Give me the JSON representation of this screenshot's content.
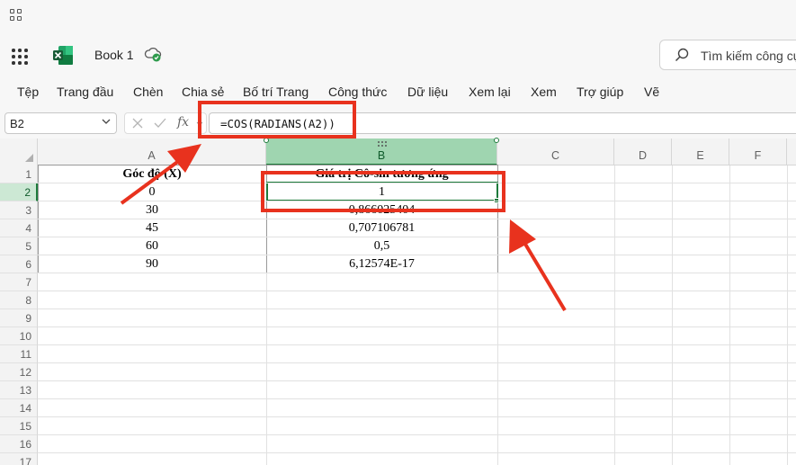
{
  "app": {
    "book_name": "Book 1",
    "search_placeholder": "Tìm kiếm công cụ"
  },
  "ribbon": {
    "tabs": [
      "Tệp",
      "Trang đầu",
      "Chèn",
      "Chia sẻ",
      "Bố trí Trang",
      "Công thức",
      "Dữ liệu",
      "Xem lại",
      "Xem",
      "Trợ giúp",
      "Vẽ"
    ]
  },
  "formula_bar": {
    "name_box": "B2",
    "fx_label": "fx",
    "formula": "=COS(RADIANS(A2))"
  },
  "sheet": {
    "columns": [
      "A",
      "B",
      "C",
      "D",
      "E",
      "F"
    ],
    "selected_column": "B",
    "selected_row": 2,
    "rows": [
      "1",
      "2",
      "3",
      "4",
      "5",
      "6",
      "7",
      "8",
      "9",
      "10",
      "11",
      "12",
      "13",
      "14",
      "15",
      "16",
      "17"
    ],
    "headers": {
      "a1": "Góc độ (X)",
      "b1": "Giá trị Cô-sin tương ứng"
    },
    "data": [
      {
        "a": "0",
        "b": "1"
      },
      {
        "a": "30",
        "b": "0,866025404"
      },
      {
        "a": "45",
        "b": "0,707106781"
      },
      {
        "a": "60",
        "b": "0,5"
      },
      {
        "a": "90",
        "b": "6,12574E-17"
      }
    ]
  },
  "colors": {
    "accent": "#1e7b3c",
    "annotation": "#e8321e"
  }
}
